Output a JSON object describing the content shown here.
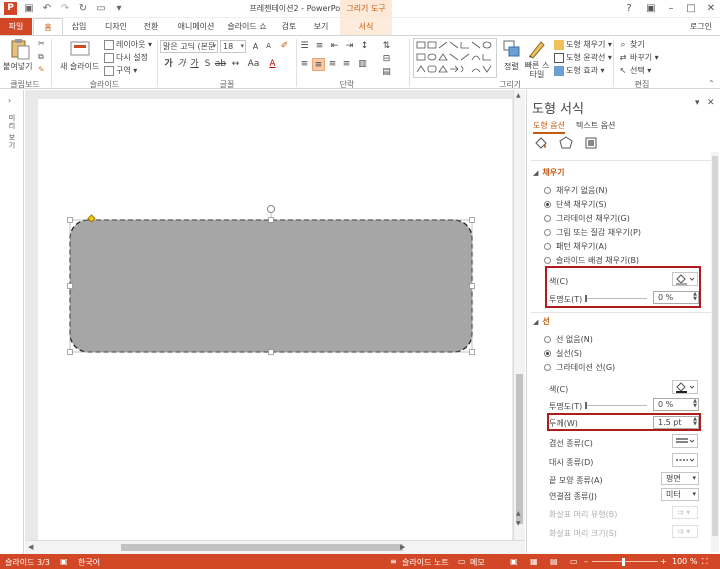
{
  "window": {
    "title": "프레젠테이션2 - PowerPoint",
    "context_tab_group": "그리기 도구",
    "login": "로그인"
  },
  "tabs": [
    "파일",
    "홈",
    "삽입",
    "디자인",
    "전환",
    "애니메이션",
    "슬라이드 쇼",
    "검토",
    "보기",
    "서식"
  ],
  "active_tab": "홈",
  "ribbon": {
    "clipboard": {
      "paste": "붙여넣기",
      "group": "클립보드"
    },
    "slides": {
      "new_slide": "새 슬라이드",
      "layout": "레이아웃 ▾",
      "reset": "다시 설정",
      "section": "구역 ▾",
      "group": "슬라이드"
    },
    "font": {
      "font_name": "맑은 고딕 (본문",
      "font_size": "18",
      "group": "글꼴"
    },
    "paragraph": {
      "group": "단락"
    },
    "drawing": {
      "arrange": "정렬",
      "quick_styles": "빠른 스타일",
      "shape_fill": "도형 채우기 ▾",
      "shape_outline": "도형 윤곽선 ▾",
      "shape_effects": "도형 효과 ▾",
      "group": "그리기"
    },
    "editing": {
      "find": "찾기",
      "replace": "바꾸기 ▾",
      "select": "선택 ▾",
      "group": "편집"
    }
  },
  "thumb_strip": {
    "label": "미리 보기"
  },
  "pane": {
    "title": "도형 서식",
    "tabs": [
      "도형 옵션",
      "텍스트 옵션"
    ],
    "fill": {
      "heading": "채우기",
      "options": [
        {
          "label": "채우기 없음(N)",
          "selected": false
        },
        {
          "label": "단색 채우기(S)",
          "selected": true
        },
        {
          "label": "그라데이션 채우기(G)",
          "selected": false
        },
        {
          "label": "그림 또는 질감 채우기(P)",
          "selected": false
        },
        {
          "label": "패턴 채우기(A)",
          "selected": false
        },
        {
          "label": "슬라이드 배경 채우기(B)",
          "selected": false
        }
      ],
      "color_label": "색(C)",
      "transparency_label": "투명도(T)",
      "transparency_value": "0 %"
    },
    "line": {
      "heading": "선",
      "options": [
        {
          "label": "선 없음(N)",
          "selected": false
        },
        {
          "label": "실선(S)",
          "selected": true
        },
        {
          "label": "그라데이션 선(G)",
          "selected": false
        }
      ],
      "color_label": "색(C)",
      "transparency_label": "투명도(T)",
      "transparency_value": "0 %",
      "width_label": "두께(W)",
      "width_value": "1.5 pt",
      "compound_label": "겹선 종류(C)",
      "dash_label": "대시 종류(D)",
      "cap_label": "끝 모양 종류(A)",
      "cap_value": "평면",
      "join_label": "연결점 종류(J)",
      "join_value": "미터",
      "begin_arrow_type": "화살표 머리 유형(B)",
      "begin_arrow_size": "화살표 머리 크기(S)"
    }
  },
  "status": {
    "slide_info": "슬라이드 3/3",
    "language": "한국어",
    "notes": "슬라이드 노트",
    "comments": "메모",
    "zoom": "100 %"
  },
  "colors": {
    "accent": "#d24726",
    "accent_text": "#c55a11",
    "shape_fill": "#a6a6a6",
    "highlight": "#b01c1c"
  }
}
